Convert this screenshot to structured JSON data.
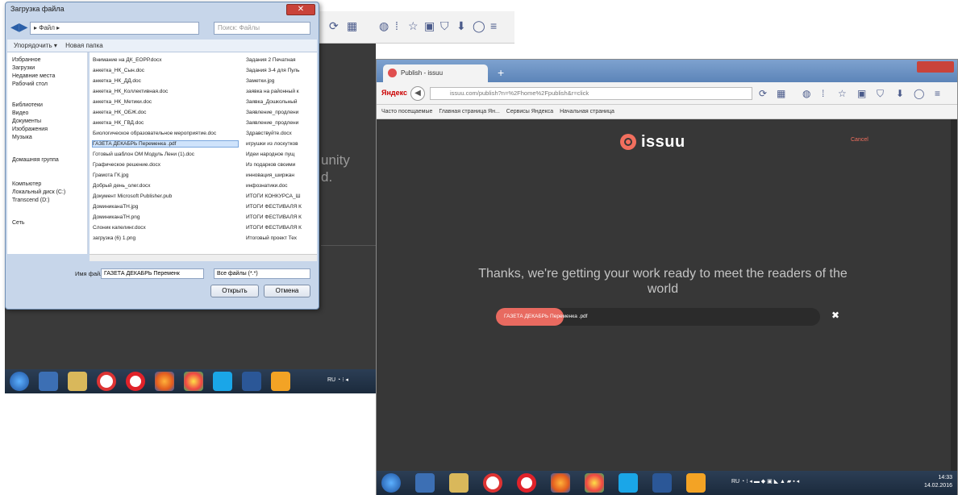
{
  "left_shot": {
    "page_text_fragments": [
      "unity",
      "d."
    ],
    "dialog": {
      "title": "Загрузка файла",
      "address": "▸ Файл ▸",
      "search_placeholder": "Поиск: Файлы",
      "commands": [
        "Упорядочить ▾",
        "Новая папка"
      ],
      "sidebar": [
        "Избранное",
        "Загрузки",
        "Недавние места",
        "Рабочий стол",
        "Библиотеки",
        "Видео",
        "Документы",
        "Изображения",
        "Музыка",
        "Домашняя группа",
        "Компьютер",
        "Локальный диск (C:)",
        "Transcend (D:)",
        "Сеть"
      ],
      "files_col1": [
        "Внимание на ДК_ЕОРР.docx",
        "анкетка_НК_Сын.doc",
        "анкетка_НК_ДД.doc",
        "анкетка_НК_Коллективная.doc",
        "анкетка_НК_Метики.doc",
        "анкетка_НК_ОБЖ.doc",
        "анкетка_НК_ГВД.doc",
        "Биологическое образовательное мероприятие.doc",
        "ГАЗЕТА ДЕКАБРЬ Переменка .pdf",
        "Готовый шаблон ОМ Модуль Лени (1).doc",
        "Графическое решение.docx",
        "Грамота ГК.jpg",
        "Добрый день_олег.docx",
        "Документ Microsoft Publisher.pub",
        "ДоминиканаТН.jpg",
        "ДоминиканаТН.png",
        "Слоник капелинг.docx",
        "загрузка (6) 1.png"
      ],
      "files_col2": [
        "Задания 2 Печатная",
        "Задания 3-4 для Пуль",
        "Заметки.jpg",
        "заявка на районный к",
        "Заявка_Дошкольный",
        "Заявление_продлени",
        "Заявление_продлени",
        "Здравствуйте.docx",
        "игрушки из лоскутков",
        "Идеи народное пущ",
        "Из подарков своими",
        "инновация_ширжан",
        "инфознатики.doc",
        "ИТОГИ КОНКУРСА_Ш",
        "ИТОГИ ФЕСТИВАЛЯ К",
        "ИТОГИ ФЕСТИВАЛЯ К",
        "ИТОГИ ФЕСТИВАЛЯ К",
        "Итоговый проект Тех"
      ],
      "selected_file_index": 8,
      "filename_label": "Имя файла:",
      "filename_value": "ГАЗЕТА ДЕКАБРЬ Переменк",
      "filetype_value": "Все файлы (*.*)",
      "open_button": "Открыть",
      "cancel_button": "Отмена"
    }
  },
  "right_shot": {
    "tab_title": "Publish - issuu",
    "new_tab": "+",
    "yandex": "Яндекс",
    "url": "issuu.com/publish?n=%2Fhome%2Fpublish&r=click",
    "bookmarks": [
      "Часто посещаемые",
      "Главная страница Ян...",
      "Сервисы Яндекса",
      "Начальная страница"
    ],
    "logo_text": "issuu",
    "cancel_link": "Cancel",
    "message": "Thanks, we're getting your work ready to meet the readers of the world",
    "upload_file": "ГАЗЕТА ДЕКАБРЬ Переменка .pdf",
    "upload_progress": 0.21,
    "close_symbol": "✖",
    "clock_time": "14:33",
    "clock_date": "14.02.2016"
  },
  "colors": {
    "issuu_accent": "#f26f5e",
    "page_bg": "#373737",
    "taskbar": "#1b2a3c"
  }
}
